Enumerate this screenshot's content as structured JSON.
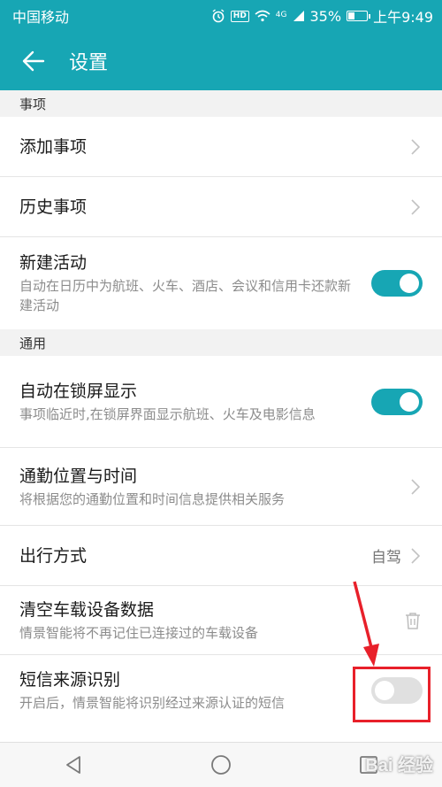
{
  "status_bar": {
    "carrier": "中国移动",
    "network": "4G",
    "battery": "35%",
    "battery_level": 0.35,
    "time": "上午9:49",
    "hd": "HD"
  },
  "header": {
    "title": "设置"
  },
  "sections": {
    "events": {
      "header": "事项"
    },
    "general": {
      "header": "通用"
    }
  },
  "rows": {
    "add_event": {
      "title": "添加事项"
    },
    "history_event": {
      "title": "历史事项"
    },
    "new_activity": {
      "title": "新建活动",
      "subtitle": "自动在日历中为航班、火车、酒店、会议和信用卡还款新建活动",
      "enabled": true
    },
    "lockscreen": {
      "title": "自动在锁屏显示",
      "subtitle": "事项临近时,在锁屏界面显示航班、火车及电影信息",
      "enabled": true
    },
    "commute": {
      "title": "通勤位置与时间",
      "subtitle": "将根据您的通勤位置和时间信息提供相关服务"
    },
    "travel_mode": {
      "title": "出行方式",
      "value": "自驾"
    },
    "clear_car": {
      "title": "清空车载设备数据",
      "subtitle": "情景智能将不再记住已连接过的车载设备"
    },
    "sms_source": {
      "title": "短信来源识别",
      "subtitle": "开启后，情景智能将识别经过来源认证的短信",
      "enabled": false
    }
  },
  "watermark": {
    "text": "Bai 经验"
  },
  "colors": {
    "accent": "#17a6b4",
    "highlight": "#e8202a"
  }
}
